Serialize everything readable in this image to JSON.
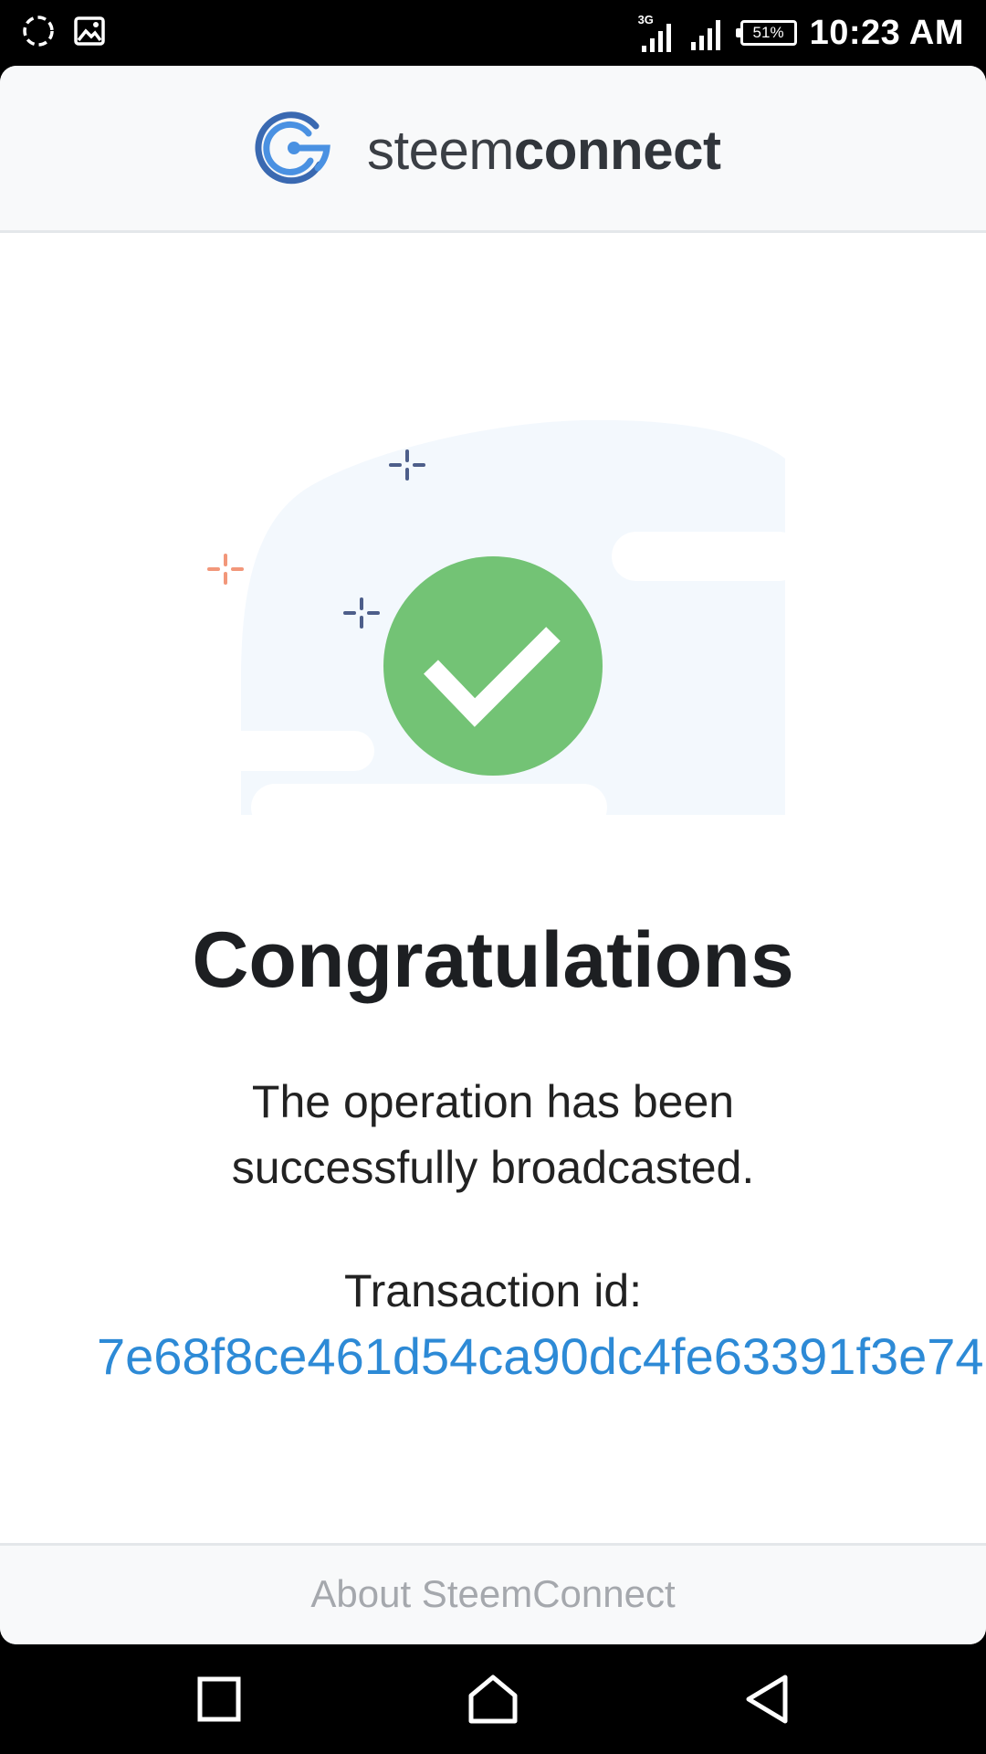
{
  "status_bar": {
    "time": "10:23 AM",
    "battery": "51%",
    "network": "3G",
    "icons": [
      "sync-icon",
      "image-icon",
      "signal-3g-icon",
      "signal-icon",
      "battery-icon"
    ]
  },
  "header": {
    "brand_light": "steem",
    "brand_bold": "connect",
    "logo": "steemconnect-logo"
  },
  "main": {
    "title": "Congratulations",
    "message": "The operation has been successfully broadcasted.",
    "tx_label": "Transaction id:",
    "tx_id": "7e68f8ce461d54ca90dc4fe63391f3e74",
    "icon": "check-circle-icon"
  },
  "footer": {
    "link": "About SteemConnect"
  },
  "nav_bar": {
    "icons": [
      "recent-apps-icon",
      "home-icon",
      "back-icon"
    ]
  },
  "colors": {
    "accent": "#2d8ad6",
    "success": "#73c375",
    "sparkle_blue": "#4d5e8a",
    "sparkle_orange": "#f2977a"
  }
}
